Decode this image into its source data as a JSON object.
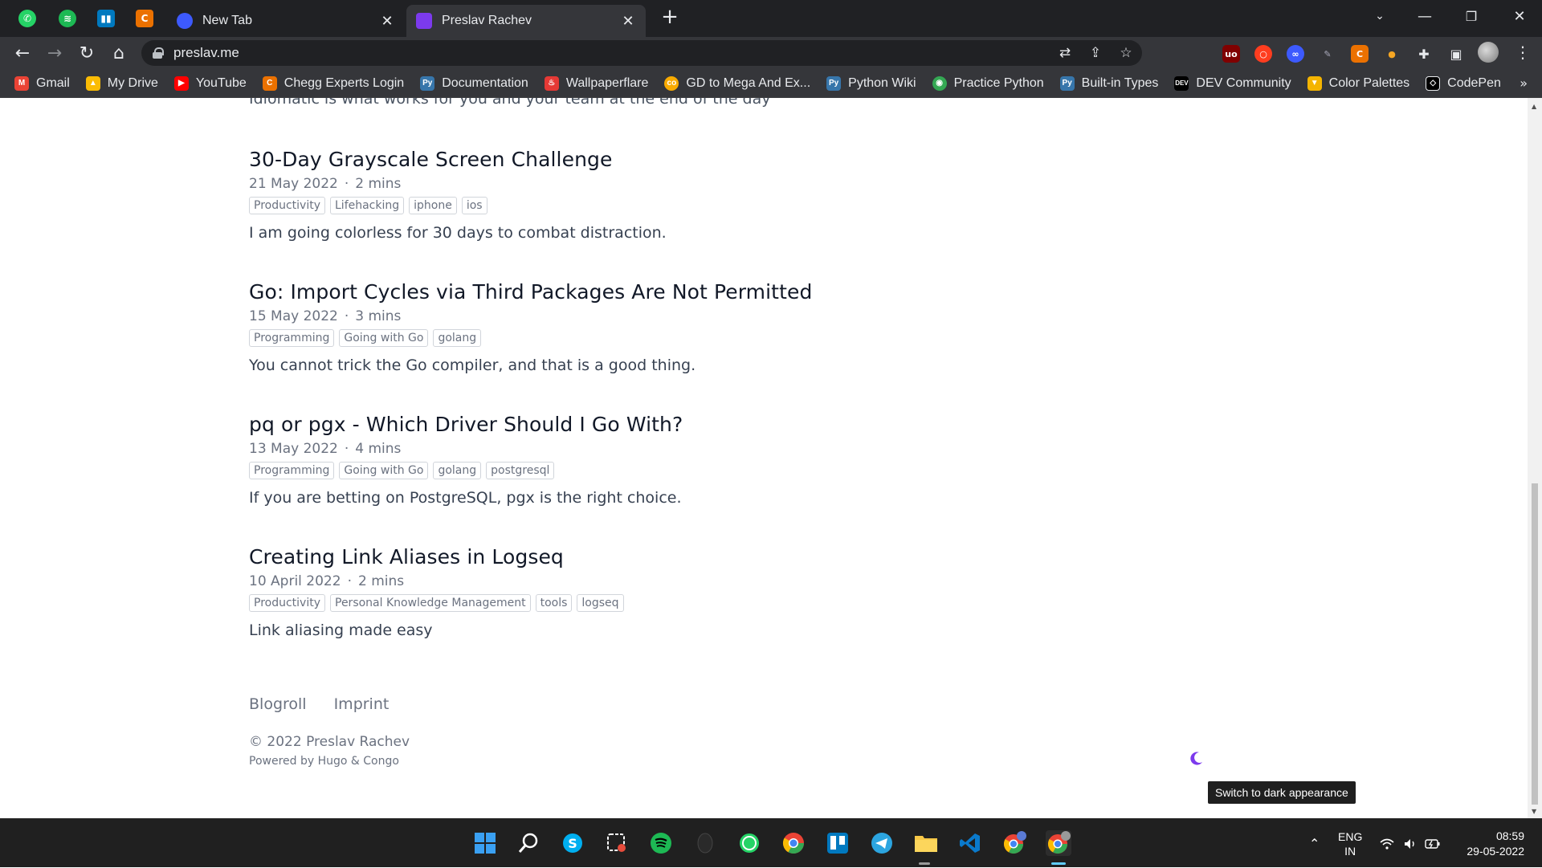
{
  "browser": {
    "tabs": [
      {
        "title": "New Tab",
        "active": false
      },
      {
        "title": "Preslav Rachev",
        "active": true
      }
    ],
    "url": "preslav.me",
    "bookmarks": [
      {
        "label": "Gmail",
        "icon": "gmail-icon",
        "color": "#ea4335"
      },
      {
        "label": "My Drive",
        "icon": "drive-icon",
        "color": "#fbbc04"
      },
      {
        "label": "YouTube",
        "icon": "youtube-icon",
        "color": "#ff0000"
      },
      {
        "label": "Chegg Experts Login",
        "icon": "chegg-icon",
        "color": "#eb7100"
      },
      {
        "label": "Documentation",
        "icon": "python-icon",
        "color": "#3776ab"
      },
      {
        "label": "Wallpaperflare",
        "icon": "flame-icon",
        "color": "#e53935"
      },
      {
        "label": "GD to Mega And Ex...",
        "icon": "colab-icon",
        "color": "#f9ab00"
      },
      {
        "label": "Python Wiki",
        "icon": "python-icon",
        "color": "#3776ab"
      },
      {
        "label": "Practice Python",
        "icon": "chrome-icon",
        "color": "#34a853"
      },
      {
        "label": "Built-in Types",
        "icon": "python-icon",
        "color": "#3776ab"
      },
      {
        "label": "DEV Community",
        "icon": "dev-icon",
        "color": "#000000"
      },
      {
        "label": "Color Palettes",
        "icon": "palette-icon",
        "color": "#f4b400"
      },
      {
        "label": "CodePen",
        "icon": "codepen-icon",
        "color": "#000000"
      }
    ],
    "bookmarks_more": "»"
  },
  "page": {
    "cut_off_text": "Idiomatic is what works for you and your team at the end of the day",
    "articles": [
      {
        "title": "30-Day Grayscale Screen Challenge",
        "date": "21 May 2022",
        "read_time": "2 mins",
        "tags": [
          "Productivity",
          "Lifehacking",
          "iphone",
          "ios"
        ],
        "summary": "I am going colorless for 30 days to combat distraction."
      },
      {
        "title": "Go: Import Cycles via Third Packages Are Not Permitted",
        "date": "15 May 2022",
        "read_time": "3 mins",
        "tags": [
          "Programming",
          "Going with Go",
          "golang"
        ],
        "summary": "You cannot trick the Go compiler, and that is a good thing."
      },
      {
        "title": "pq or pgx - Which Driver Should I Go With?",
        "date": "13 May 2022",
        "read_time": "4 mins",
        "tags": [
          "Programming",
          "Going with Go",
          "golang",
          "postgresql"
        ],
        "summary": "If you are betting on PostgreSQL, pgx is the right choice."
      },
      {
        "title": "Creating Link Aliases in Logseq",
        "date": "10 April 2022",
        "read_time": "2 mins",
        "tags": [
          "Productivity",
          "Personal Knowledge Management",
          "tools",
          "logseq"
        ],
        "summary": "Link aliasing made easy"
      }
    ],
    "meta_separator": "·",
    "footer": {
      "links": [
        "Blogroll",
        "Imprint"
      ],
      "copyright": "© 2022 Preslav Rachev",
      "powered_by": "Powered by Hugo & Congo"
    },
    "appearance_tooltip": "Switch to dark appearance",
    "accent_color": "#7c3aed"
  },
  "taskbar": {
    "apps": [
      "windows-start-icon",
      "search-icon",
      "skype-icon",
      "snipping-tool-icon",
      "spotify-icon",
      "alienware-icon",
      "whatsapp-icon",
      "chrome-icon",
      "trello-icon",
      "telegram-icon",
      "file-explorer-icon",
      "vscode-icon",
      "chrome-profile-icon",
      "chrome-active-icon"
    ],
    "language_line1": "ENG",
    "language_line2": "IN",
    "time": "08:59",
    "date": "29-05-2022"
  }
}
